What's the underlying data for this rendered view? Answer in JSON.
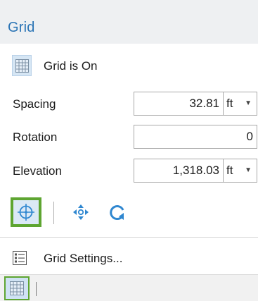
{
  "panel": {
    "title": "Grid"
  },
  "status": {
    "label": "Grid is On"
  },
  "fields": {
    "spacing": {
      "label": "Spacing",
      "value": "32.81",
      "unit": "ft"
    },
    "rotation": {
      "label": "Rotation",
      "value": "0"
    },
    "elevation": {
      "label": "Elevation",
      "value": "1,318.03",
      "unit": "ft"
    }
  },
  "tools": [
    {
      "name": "center-snap-icon",
      "active": true
    },
    {
      "name": "move-icon",
      "active": false
    },
    {
      "name": "rotate-icon",
      "active": false
    }
  ],
  "settings": {
    "label": "Grid Settings..."
  },
  "colors": {
    "title": "#2a74b5",
    "active_border": "#5ea531",
    "icon_blue": "#2f87d0"
  }
}
